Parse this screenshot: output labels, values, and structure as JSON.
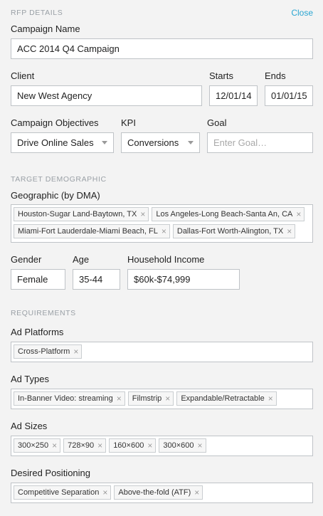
{
  "panel": {
    "rfp_title": "RFP DETAILS",
    "close_label": "Close"
  },
  "campaign": {
    "label": "Campaign Name",
    "value": "ACC 2014 Q4 Campaign"
  },
  "client": {
    "label": "Client",
    "value": "New West Agency"
  },
  "starts": {
    "label": "Starts",
    "value": "12/01/14"
  },
  "ends": {
    "label": "Ends",
    "value": "01/01/15"
  },
  "objectives": {
    "label": "Campaign Objectives",
    "value": "Drive Online Sales"
  },
  "kpi": {
    "label": "KPI",
    "value": "Conversions"
  },
  "goal": {
    "label": "Goal",
    "placeholder": "Enter Goal…"
  },
  "demographic": {
    "title": "TARGET DEMOGRAPHIC"
  },
  "geo": {
    "label": "Geographic (by DMA)",
    "tags": [
      "Houston-Sugar Land-Baytown, TX",
      "Los Angeles-Long Beach-Santa An, CA",
      "Miami-Fort Lauderdale-Miami Beach, FL",
      "Dallas-Fort Worth-Alington, TX"
    ]
  },
  "gender": {
    "label": "Gender",
    "value": "Female"
  },
  "age": {
    "label": "Age",
    "value": "35-44"
  },
  "income": {
    "label": "Household Income",
    "value": "$60k-$74,999"
  },
  "requirements": {
    "title": "REQUIREMENTS"
  },
  "platforms": {
    "label": "Ad Platforms",
    "tags": [
      "Cross-Platform"
    ]
  },
  "types": {
    "label": "Ad Types",
    "tags": [
      "In-Banner Video: streaming",
      "Filmstrip",
      "Expandable/Retractable"
    ]
  },
  "sizes": {
    "label": "Ad Sizes",
    "tags": [
      "300×250",
      "728×90",
      "160×600",
      "300×600"
    ]
  },
  "positioning": {
    "label": "Desired Positioning",
    "tags": [
      "Competitive Separation",
      "Above-the-fold (ATF)"
    ]
  },
  "icons": {
    "remove": "×"
  }
}
